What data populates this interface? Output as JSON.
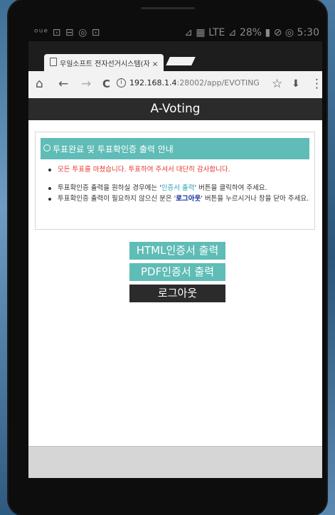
{
  "status": {
    "left": "ᵒᵘᵉ ⊡ ⊟ ◎ ⊡",
    "right": "⊿ ▦ LTE ⊿ 28% ▮ ⊘ ◎ 5:30"
  },
  "tab": {
    "title": "우일소프트 전자선거시스템(자 ×"
  },
  "url": {
    "host": "192.168.1.4",
    "path": ":28002/app/EVOTING"
  },
  "icons": {
    "home": "⌂",
    "back": "←",
    "forward": "→",
    "reload": "C",
    "info": "i",
    "star": "☆",
    "download": "⬇",
    "menu": "⋮"
  },
  "app": {
    "title": "A-Voting"
  },
  "panel": {
    "title": "투표완료 및 투표확인증 출력 안내",
    "item1": "모든 투표를 마쳤습니다. 투표하여 주셔서 대단히 감사합니다.",
    "item2_pre": "투표확인증 출력을 원하실 경우에는 '",
    "item2_link": "인증서 출력",
    "item2_post": "' 버튼을 클릭하여 주세요.",
    "item3_pre": "투표확인증 출력이 필요하지 않으신 분은 '",
    "item3_link": "로그아웃",
    "item3_post": "' 버튼을 누르시거나 창을 닫아 주세요."
  },
  "buttons": {
    "html": "HTML인증서 출력",
    "pdf": "PDF인증서 출력",
    "logout": "로그아웃"
  },
  "colors": {
    "accent": "#5fbcb6",
    "dark": "#2b2b2b",
    "warning": "#e8352f",
    "link": "#2aa3b3",
    "strong": "#0f2a9c"
  }
}
